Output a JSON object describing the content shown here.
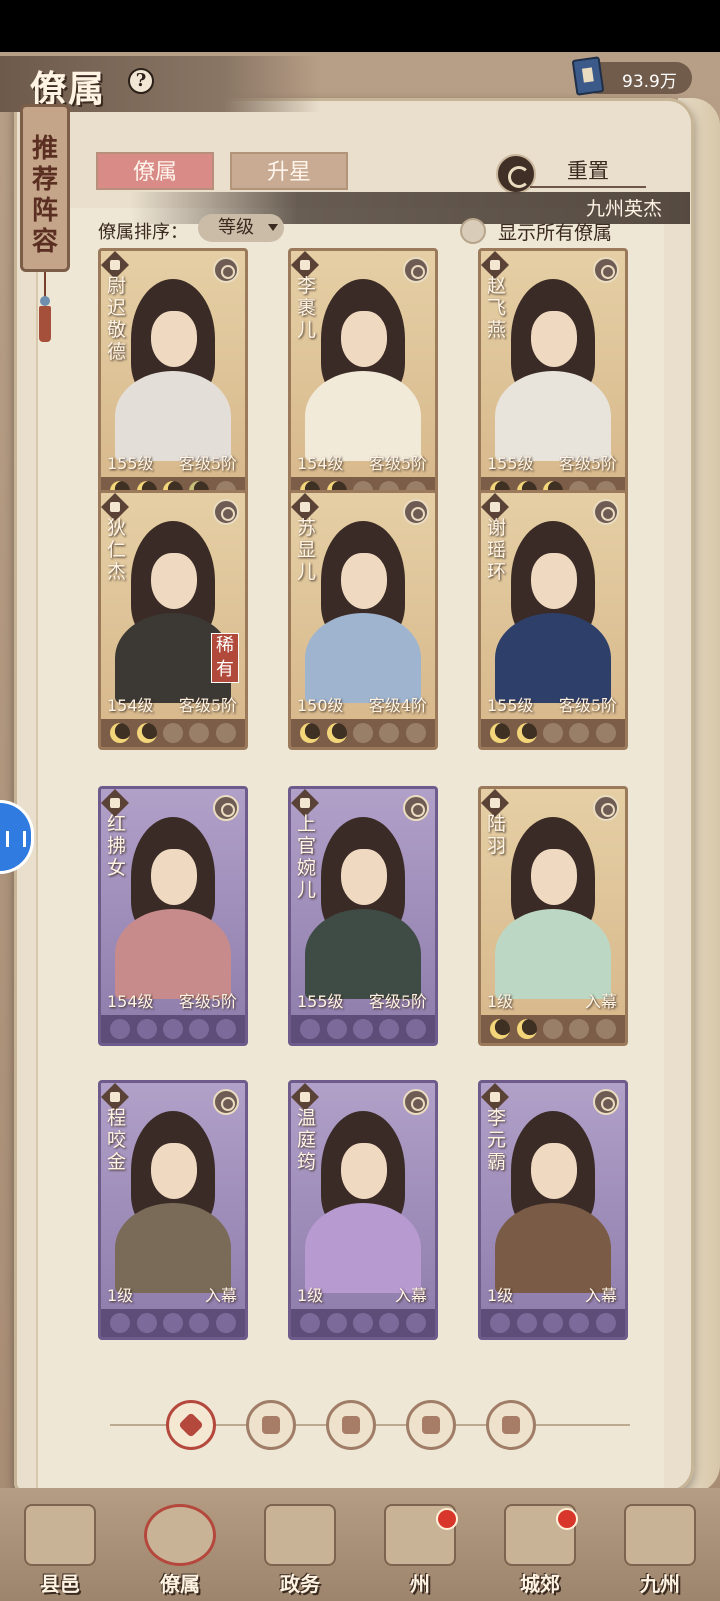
{
  "header": {
    "title": "僚属",
    "help_symbol": "?",
    "currency_value": "93.9万"
  },
  "side_tab": {
    "label": "推荐阵容"
  },
  "tabs": [
    {
      "label": "僚属",
      "active": true
    },
    {
      "label": "升星",
      "active": false
    }
  ],
  "reset_label": "重置",
  "banner_text": "九州英杰",
  "sort": {
    "label": "僚属排序：",
    "value": "等级"
  },
  "show_all_label": "显示所有僚属",
  "cards": [
    {
      "name": "尉迟敬德",
      "level": "155级",
      "rank": "客级5阶",
      "style": "gold",
      "moons": [
        "on",
        "on",
        "on",
        "half",
        "off"
      ]
    },
    {
      "name": "李裹儿",
      "level": "154级",
      "rank": "客级5阶",
      "style": "gold",
      "moons": [
        "on",
        "on",
        "off",
        "off",
        "off"
      ]
    },
    {
      "name": "赵飞燕",
      "level": "155级",
      "rank": "客级5阶",
      "style": "gold",
      "moons": [
        "on",
        "on",
        "on",
        "off",
        "off"
      ]
    },
    {
      "name": "狄仁杰",
      "level": "154级",
      "rank": "客级5阶",
      "style": "gold",
      "rare": "稀有",
      "moons": [
        "on",
        "on",
        "off",
        "off",
        "off"
      ]
    },
    {
      "name": "苏显儿",
      "level": "150级",
      "rank": "客级4阶",
      "style": "gold",
      "moons": [
        "on",
        "on",
        "off",
        "off",
        "off"
      ]
    },
    {
      "name": "谢瑶环",
      "level": "155级",
      "rank": "客级5阶",
      "style": "gold",
      "moons": [
        "on",
        "on",
        "off",
        "off",
        "off"
      ]
    },
    {
      "name": "红拂女",
      "level": "154级",
      "rank": "客级5阶",
      "style": "purple",
      "moons": [
        "on",
        "on",
        "off",
        "off",
        "off"
      ]
    },
    {
      "name": "上官婉儿",
      "level": "155级",
      "rank": "客级5阶",
      "style": "purple",
      "moons": [
        "on",
        "off",
        "off",
        "off",
        "off"
      ]
    },
    {
      "name": "陆羽",
      "level": "1级",
      "rank": "入幕",
      "style": "gold",
      "moons": [
        "on",
        "on",
        "off",
        "off",
        "off"
      ]
    },
    {
      "name": "程咬金",
      "level": "1级",
      "rank": "入幕",
      "style": "purple",
      "moons": [
        "on",
        "on",
        "off",
        "off",
        "off"
      ]
    },
    {
      "name": "温庭筠",
      "level": "1级",
      "rank": "入幕",
      "style": "purple",
      "moons": [
        "on",
        "on",
        "off",
        "off",
        "off"
      ]
    },
    {
      "name": "李元霸",
      "level": "1级",
      "rank": "入幕",
      "style": "purple",
      "moons": [
        "on",
        "on",
        "on",
        "bright",
        "off"
      ]
    }
  ],
  "filters": [
    {
      "name": "filter-all-icon",
      "active": true
    },
    {
      "name": "filter-bell-icon",
      "active": false
    },
    {
      "name": "filter-pen-icon",
      "active": false
    },
    {
      "name": "filter-fan-icon",
      "active": false
    },
    {
      "name": "filter-ship-icon",
      "active": false
    }
  ],
  "bottom_nav": [
    {
      "label": "县邑",
      "badge": false,
      "active": false
    },
    {
      "label": "僚属",
      "badge": false,
      "active": true
    },
    {
      "label": "政务",
      "badge": false,
      "active": false
    },
    {
      "label": "州",
      "badge": true,
      "active": false
    },
    {
      "label": "城郊",
      "badge": true,
      "active": false
    },
    {
      "label": "九州",
      "badge": false,
      "active": false
    }
  ],
  "colors": {
    "accent_red": "#b5483d",
    "gold_card": "#e6cfa5",
    "purple_card": "#b1a0c8",
    "parchment": "#efe7d6"
  }
}
